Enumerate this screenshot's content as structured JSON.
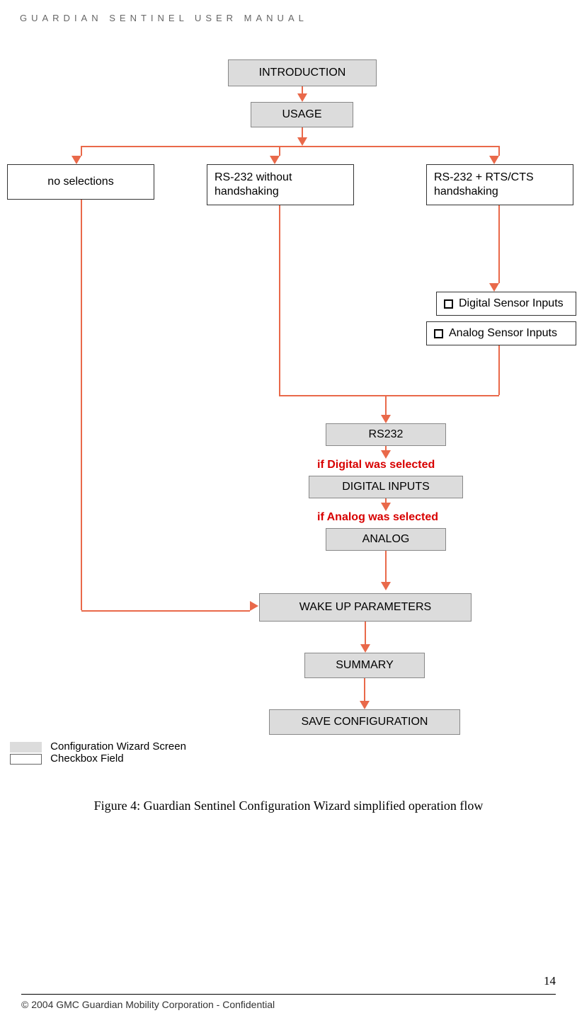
{
  "header": "GUARDIAN SENTINEL USER MANUAL",
  "nodes": {
    "introduction": "INTRODUCTION",
    "usage": "USAGE",
    "no_selections": "no selections",
    "rs232_nohs": "RS-232 without handshaking",
    "rs232_rtscts": "RS-232 + RTS/CTS handshaking",
    "digital_sensor": "Digital Sensor Inputs",
    "analog_sensor": "Analog Sensor Inputs",
    "rs232": "RS232",
    "cond_digital": "if Digital was selected",
    "digital_inputs": "DIGITAL INPUTS",
    "cond_analog": "if Analog was selected",
    "analog": "ANALOG",
    "wakeup": "WAKE UP PARAMETERS",
    "summary": "SUMMARY",
    "save": "SAVE CONFIGURATION"
  },
  "legend": {
    "screen": "Configuration Wizard Screen",
    "checkbox": "Checkbox Field"
  },
  "caption": "Figure 4: Guardian Sentinel Configuration Wizard simplified operation flow",
  "footer_text": "© 2004 GMC Guardian Mobility Corporation - Confidential",
  "page_number": "14",
  "colors": {
    "arrow": "#e9694a",
    "screen_fill": "#dcdcdc",
    "condition_text": "#d80000"
  }
}
